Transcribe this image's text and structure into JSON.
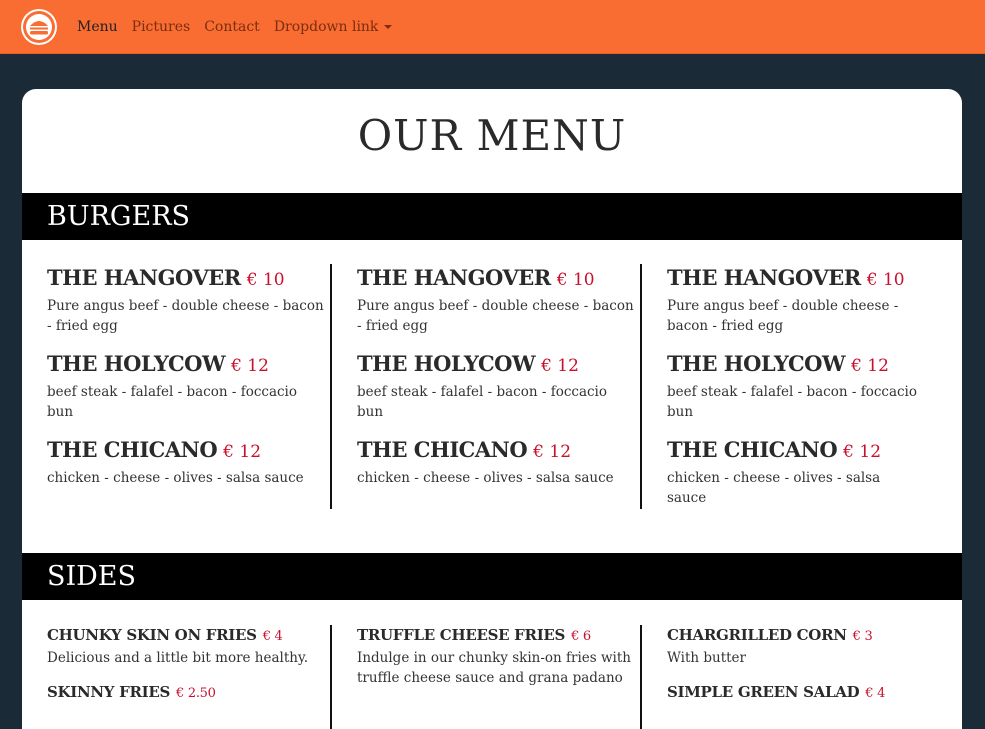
{
  "nav": {
    "brand_icon": "burger-logo",
    "links": [
      {
        "label": "Menu",
        "active": true
      },
      {
        "label": "Pictures"
      },
      {
        "label": "Contact"
      },
      {
        "label": "Dropdown link"
      }
    ]
  },
  "page_title": "OUR MENU",
  "sections": {
    "burgers": {
      "title": "BURGERS",
      "columns": [
        [
          {
            "name": "THE HANGOVER",
            "price": "€ 10",
            "desc": "Pure angus beef - double cheese - bacon - fried egg"
          },
          {
            "name": "THE HOLYCOW",
            "price": "€ 12",
            "desc": "beef steak - falafel - bacon - foccacio bun"
          },
          {
            "name": "THE CHICANO",
            "price": "€ 12",
            "desc": "chicken - cheese - olives - salsa sauce"
          }
        ],
        [
          {
            "name": "THE HANGOVER",
            "price": "€ 10",
            "desc": "Pure angus beef - double cheese - bacon - fried egg"
          },
          {
            "name": "THE HOLYCOW",
            "price": "€ 12",
            "desc": "beef steak - falafel - bacon - foccacio bun"
          },
          {
            "name": "THE CHICANO",
            "price": "€ 12",
            "desc": "chicken - cheese - olives - salsa sauce"
          }
        ],
        [
          {
            "name": "THE HANGOVER",
            "price": "€ 10",
            "desc": "Pure angus beef - double cheese - bacon - fried egg"
          },
          {
            "name": "THE HOLYCOW",
            "price": "€ 12",
            "desc": "beef steak - falafel - bacon - foccacio bun"
          },
          {
            "name": "THE CHICANO",
            "price": "€ 12",
            "desc": "chicken - cheese - olives - salsa sauce"
          }
        ]
      ]
    },
    "sides": {
      "title": "SIDES",
      "columns": [
        [
          {
            "name": "CHUNKY SKIN ON FRIES",
            "price": "€ 4",
            "desc": "Delicious and a little bit more healthy."
          },
          {
            "name": "SKINNY FRIES",
            "price": "€ 2.50",
            "desc": ""
          }
        ],
        [
          {
            "name": "TRUFFLE CHEESE FRIES",
            "price": "€ 6",
            "desc": "Indulge in our chunky skin-on fries with truffle cheese sauce and grana padano"
          }
        ],
        [
          {
            "name": "CHARGRILLED CORN",
            "price": "€ 3",
            "desc": "With butter"
          },
          {
            "name": "SIMPLE GREEN SALAD",
            "price": "€ 4",
            "desc": ""
          }
        ]
      ]
    }
  },
  "colors": {
    "navbar": "#f96d32",
    "background": "#1a2a36",
    "price": "#c8102e"
  }
}
